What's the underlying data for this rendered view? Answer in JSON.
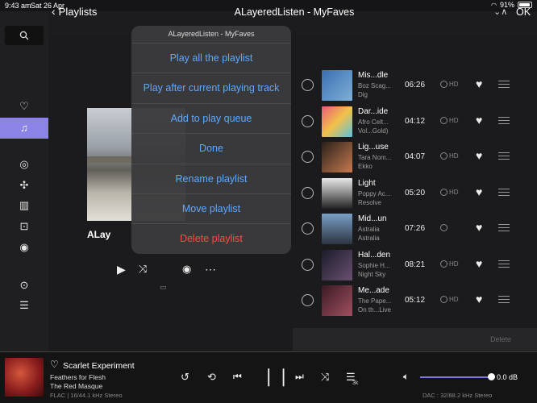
{
  "status_bar": {
    "time": "9:43 am",
    "date": "Sat 26 Apr",
    "battery": "91%",
    "battery_level": 0.91
  },
  "header": {
    "back_label": "Playlists",
    "title": "ALayeredListen - MyFaves",
    "ok_label": "OK",
    "sort_icon": "sort-toggle-icon"
  },
  "sidebar": {
    "items": [
      "search-icon",
      "heart-icon",
      "playlist-icon",
      "qobuz-icon",
      "tidal-icon",
      "library-icon",
      "radio-icon",
      "podcast-icon",
      "view-icon",
      "settings-sliders-icon"
    ]
  },
  "playlist": {
    "name": "ALay"
  },
  "menu": {
    "title": "ALayeredListen - MyFaves",
    "items": [
      "Play all the playlist",
      "Play after current playing track",
      "Add to play queue",
      "Done",
      "Rename playlist",
      "Move playlist",
      "Delete playlist"
    ]
  },
  "tracks": [
    {
      "title": "Mis...dle",
      "artist": "Boz Scag...",
      "album": "Dig",
      "duration": "06:26",
      "quality": "HD"
    },
    {
      "title": "Dar...ide",
      "artist": "Afro Celt...",
      "album": "Vol...Gold)",
      "duration": "04:12",
      "quality": "HD"
    },
    {
      "title": "Lig...use",
      "artist": "Tara Nom...",
      "album": "Ekko",
      "duration": "04:07",
      "quality": "HD"
    },
    {
      "title": "Light",
      "artist": "Poppy Ac...",
      "album": "Resolve",
      "duration": "05:20",
      "quality": "HD"
    },
    {
      "title": "Mid...un",
      "artist": "Astralia",
      "album": "Astralia",
      "duration": "07:26",
      "quality": ""
    },
    {
      "title": "Hal...den",
      "artist": "Sophie H...",
      "album": "Night Sky",
      "duration": "08:21",
      "quality": "HD"
    },
    {
      "title": "Me...ade",
      "artist": "The Pape...",
      "album": "On th...Live",
      "duration": "05:12",
      "quality": "HD"
    }
  ],
  "delete_label": "Delete",
  "now_playing": {
    "title": "Scarlet Experiment",
    "album": "Feathers for Flesh",
    "artist": "The Red Masque",
    "format": "FLAC | 16/44.1 kHz Stereo",
    "queue_count": "3k",
    "volume": "0.0 dB",
    "volume_level": 1.0,
    "dac": "DAC : 32/88.2 kHz Stereo"
  },
  "colors": {
    "accent": "#8b84e6",
    "menu_blue": "#5ea8ff",
    "menu_red": "#ff4b41"
  }
}
